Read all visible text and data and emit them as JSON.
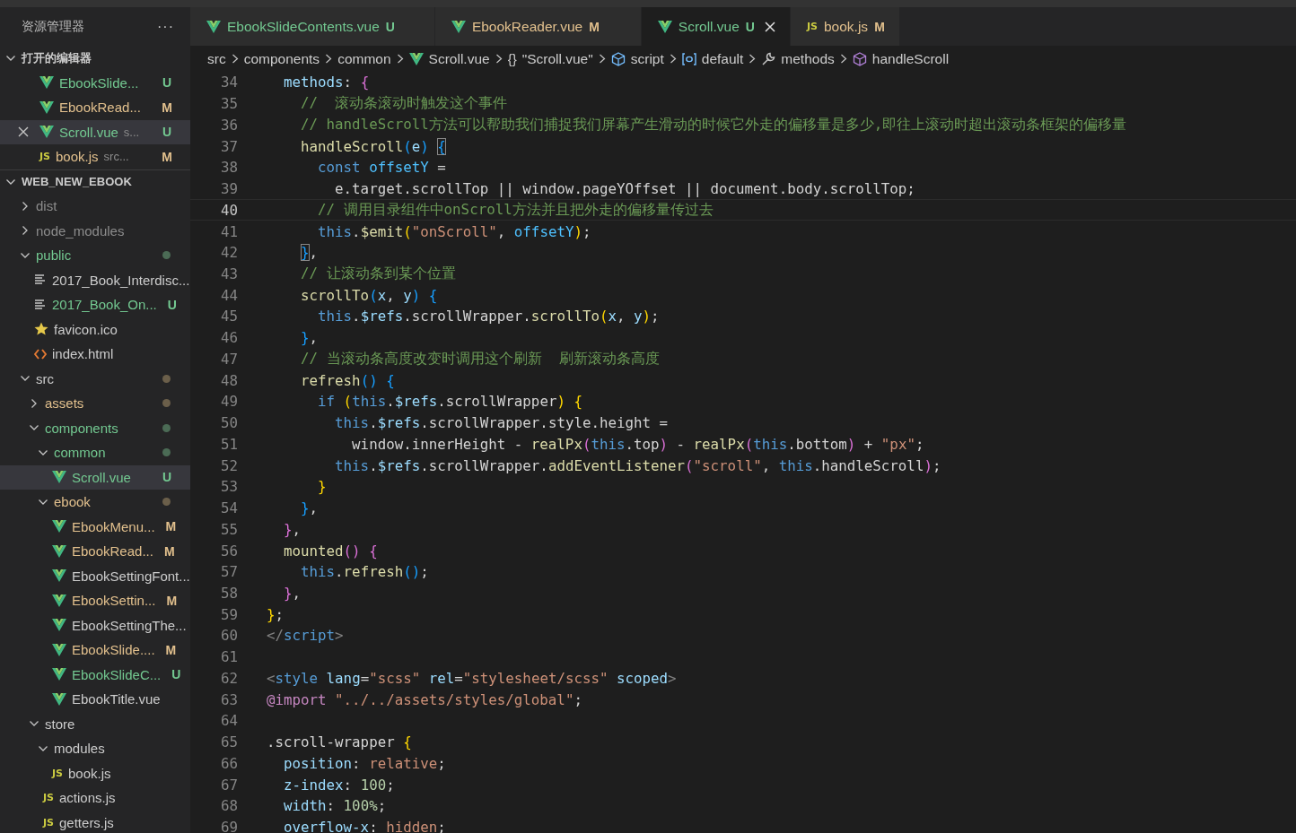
{
  "tabs": [
    {
      "label": "EbookSlideContents.vue",
      "kind": "vue",
      "status": "U",
      "color": "#73c991",
      "selected": false
    },
    {
      "label": "EbookReader.vue",
      "kind": "vue",
      "status": "M",
      "color": "#e2c08d",
      "selected": false
    },
    {
      "label": "Scroll.vue",
      "kind": "vue",
      "status": "U",
      "color": "#73c991",
      "selected": true
    },
    {
      "label": "book.js",
      "kind": "js",
      "icon_label": "JS",
      "status": "M",
      "color": "#e2c08d",
      "selected": false
    }
  ],
  "sidebar": {
    "title": "资源管理器",
    "more": "···",
    "open_editors": {
      "title": "打开的编辑器",
      "expanded": true,
      "items": [
        {
          "kind": "vue",
          "name": "EbookSlide...",
          "status": "U",
          "color": "#73c991",
          "selected": false
        },
        {
          "kind": "vue",
          "name": "EbookRead...",
          "status": "M",
          "color": "#e2c08d",
          "selected": false
        },
        {
          "kind": "vue",
          "name": "Scroll.vue",
          "description": "s...",
          "status": "U",
          "color": "#73c991",
          "selected": true
        },
        {
          "kind": "js",
          "icon_label": "JS",
          "name": "book.js",
          "description": "src...",
          "status": "M",
          "color": "#e2c08d",
          "selected": false
        }
      ]
    },
    "folder": {
      "title": "WEB_NEW_EBOOK",
      "expanded": true,
      "children": [
        {
          "label": "dist",
          "kind": "folder",
          "expanded": false,
          "color": "#8c8c8c",
          "selected": false
        },
        {
          "label": "node_modules",
          "kind": "folder",
          "expanded": false,
          "color": "#8c8c8c",
          "selected": false
        },
        {
          "label": "public",
          "kind": "folder",
          "expanded": true,
          "color": "#73c991",
          "dot": {
            "color": "#4b6b55"
          },
          "selected": false,
          "children": [
            {
              "label": "2017_Book_Interdisc...",
              "kind": "text",
              "color": "#cccccc",
              "selected": false
            },
            {
              "label": "2017_Book_On...",
              "kind": "text",
              "color": "#73c991",
              "status": "U",
              "selected": false
            },
            {
              "label": "favicon.ico",
              "kind": "star",
              "color": "#cccccc",
              "selected": false
            },
            {
              "label": "index.html",
              "kind": "html",
              "color": "#cccccc",
              "selected": false
            }
          ]
        },
        {
          "label": "src",
          "kind": "folder",
          "expanded": true,
          "color": "#cccccc",
          "dot": {
            "color": "#6b5f4a"
          },
          "selected": false,
          "children": [
            {
              "label": "assets",
              "kind": "folder",
              "expanded": false,
              "color": "#e2c08d",
              "dot": {
                "color": "#6b5f4a"
              },
              "selected": false
            },
            {
              "label": "components",
              "kind": "folder",
              "expanded": true,
              "color": "#73c991",
              "dot": {
                "color": "#4b6b55"
              },
              "selected": false,
              "children": [
                {
                  "label": "common",
                  "kind": "folder",
                  "expanded": true,
                  "color": "#73c991",
                  "dot": {
                    "color": "#4b6b55"
                  },
                  "selected": false,
                  "children": [
                    {
                      "label": "Scroll.vue",
                      "kind": "vue",
                      "color": "#73c991",
                      "status": "U",
                      "selected": true
                    }
                  ]
                },
                {
                  "label": "ebook",
                  "kind": "folder",
                  "expanded": true,
                  "color": "#e2c08d",
                  "dot": {
                    "color": "#6b5f4a"
                  },
                  "selected": false,
                  "children": [
                    {
                      "label": "EbookMenu...",
                      "kind": "vue",
                      "color": "#e2c08d",
                      "status": "M",
                      "selected": false
                    },
                    {
                      "label": "EbookRead...",
                      "kind": "vue",
                      "color": "#e2c08d",
                      "status": "M",
                      "selected": false
                    },
                    {
                      "label": "EbookSettingFont...",
                      "kind": "vue",
                      "color": "#cccccc",
                      "selected": false
                    },
                    {
                      "label": "EbookSettin...",
                      "kind": "vue",
                      "color": "#e2c08d",
                      "status": "M",
                      "selected": false
                    },
                    {
                      "label": "EbookSettingThe...",
                      "kind": "vue",
                      "color": "#cccccc",
                      "selected": false
                    },
                    {
                      "label": "EbookSlide....",
                      "kind": "vue",
                      "color": "#e2c08d",
                      "status": "M",
                      "selected": false
                    },
                    {
                      "label": "EbookSlideC...",
                      "kind": "vue",
                      "color": "#73c991",
                      "status": "U",
                      "selected": false
                    },
                    {
                      "label": "EbookTitle.vue",
                      "kind": "vue",
                      "color": "#cccccc",
                      "selected": false
                    }
                  ]
                }
              ]
            },
            {
              "label": "store",
              "kind": "folder",
              "expanded": true,
              "color": "#cccccc",
              "selected": false,
              "children": [
                {
                  "label": "modules",
                  "kind": "folder",
                  "expanded": true,
                  "color": "#cccccc",
                  "selected": false,
                  "children": [
                    {
                      "label": "book.js",
                      "kind": "js",
                      "icon_label": "JS",
                      "color": "#cccccc",
                      "selected": false
                    }
                  ]
                },
                {
                  "label": "actions.js",
                  "kind": "js",
                  "icon_label": "JS",
                  "color": "#cccccc",
                  "selected": false
                },
                {
                  "label": "getters.js",
                  "kind": "js",
                  "icon_label": "JS",
                  "color": "#cccccc",
                  "selected": false
                }
              ]
            }
          ]
        }
      ]
    }
  },
  "breadcrumbs": [
    {
      "kind": "plain",
      "label": "src"
    },
    {
      "kind": "plain",
      "label": "components"
    },
    {
      "kind": "plain",
      "label": "common"
    },
    {
      "kind": "vue",
      "label": "Scroll.vue"
    },
    {
      "kind": "glyph",
      "glyph": "{}",
      "label": "\"Scroll.vue\""
    },
    {
      "kind": "cube",
      "label": "script"
    },
    {
      "kind": "field",
      "label": "default"
    },
    {
      "kind": "wrench",
      "label": "methods"
    },
    {
      "kind": "method",
      "label": "handleScroll"
    }
  ],
  "editor": {
    "lines": [
      {
        "number": "34",
        "current": false,
        "tokens": [
          {
            "kind": "prop",
            "text": "  methods"
          },
          {
            "kind": "plain",
            "text": ": "
          },
          {
            "kind": "pink",
            "text": "{"
          }
        ]
      },
      {
        "number": "35",
        "current": false,
        "tokens": [
          {
            "kind": "comment",
            "text": "    //  滚动条滚动时触发这个事件"
          }
        ]
      },
      {
        "number": "36",
        "current": false,
        "tokens": [
          {
            "kind": "comment",
            "text": "    // handleScroll方法可以帮助我们捕捉我们屏幕产生滑动的时候它外走的偏移量是多少,即往上滚动时超出滚动条框架的偏移量"
          }
        ]
      },
      {
        "number": "37",
        "current": false,
        "tokens": [
          {
            "kind": "fn",
            "text": "    handleScroll"
          },
          {
            "kind": "blue",
            "text": "("
          },
          {
            "kind": "var",
            "text": "e"
          },
          {
            "kind": "blue",
            "text": ") "
          },
          {
            "kind": "match",
            "text": "{"
          }
        ]
      },
      {
        "number": "38",
        "current": false,
        "tokens": [
          {
            "kind": "keyword",
            "text": "      const "
          },
          {
            "kind": "const",
            "text": "offsetY"
          },
          {
            "kind": "plain",
            "text": " ="
          }
        ]
      },
      {
        "number": "39",
        "current": false,
        "tokens": [
          {
            "kind": "plain",
            "text": "        e.target.scrollTop || window.pageYOffset || document.body.scrollTop;"
          }
        ]
      },
      {
        "number": "40",
        "current": true,
        "tokens": [
          {
            "kind": "comment",
            "text": "      // 调用目录组件中onScroll方法并且把外走的偏移量传过去"
          }
        ]
      },
      {
        "number": "41",
        "current": false,
        "tokens": [
          {
            "kind": "keyword",
            "text": "      this"
          },
          {
            "kind": "plain",
            "text": "."
          },
          {
            "kind": "fn",
            "text": "$emit"
          },
          {
            "kind": "gold",
            "text": "("
          },
          {
            "kind": "string",
            "text": "\"onScroll\""
          },
          {
            "kind": "plain",
            "text": ", "
          },
          {
            "kind": "const",
            "text": "offsetY"
          },
          {
            "kind": "gold",
            "text": ")"
          },
          {
            "kind": "plain",
            "text": ";"
          }
        ]
      },
      {
        "number": "42",
        "current": false,
        "tokens": [
          {
            "kind": "match",
            "text": "    }"
          },
          {
            "kind": "plain",
            "text": ","
          }
        ]
      },
      {
        "number": "43",
        "current": false,
        "tokens": [
          {
            "kind": "comment",
            "text": "    // 让滚动条到某个位置"
          }
        ]
      },
      {
        "number": "44",
        "current": false,
        "tokens": [
          {
            "kind": "fn",
            "text": "    scrollTo"
          },
          {
            "kind": "blue",
            "text": "("
          },
          {
            "kind": "var",
            "text": "x"
          },
          {
            "kind": "plain",
            "text": ", "
          },
          {
            "kind": "var",
            "text": "y"
          },
          {
            "kind": "blue",
            "text": ") {"
          }
        ]
      },
      {
        "number": "45",
        "current": false,
        "tokens": [
          {
            "kind": "keyword",
            "text": "      this"
          },
          {
            "kind": "plain",
            "text": "."
          },
          {
            "kind": "var",
            "text": "$refs"
          },
          {
            "kind": "plain",
            "text": ".scrollWrapper."
          },
          {
            "kind": "fn",
            "text": "scrollTo"
          },
          {
            "kind": "gold",
            "text": "("
          },
          {
            "kind": "var",
            "text": "x"
          },
          {
            "kind": "plain",
            "text": ", "
          },
          {
            "kind": "var",
            "text": "y"
          },
          {
            "kind": "gold",
            "text": ")"
          },
          {
            "kind": "plain",
            "text": ";"
          }
        ]
      },
      {
        "number": "46",
        "current": false,
        "tokens": [
          {
            "kind": "blue",
            "text": "    }"
          },
          {
            "kind": "plain",
            "text": ","
          }
        ]
      },
      {
        "number": "47",
        "current": false,
        "tokens": [
          {
            "kind": "comment",
            "text": "    // 当滚动条高度改变时调用这个刷新  刷新滚动条高度"
          }
        ]
      },
      {
        "number": "48",
        "current": false,
        "tokens": [
          {
            "kind": "fn",
            "text": "    refresh"
          },
          {
            "kind": "blue",
            "text": "() {"
          }
        ]
      },
      {
        "number": "49",
        "current": false,
        "tokens": [
          {
            "kind": "keyword",
            "text": "      if "
          },
          {
            "kind": "gold",
            "text": "("
          },
          {
            "kind": "keyword",
            "text": "this"
          },
          {
            "kind": "plain",
            "text": "."
          },
          {
            "kind": "var",
            "text": "$refs"
          },
          {
            "kind": "plain",
            "text": ".scrollWrapper"
          },
          {
            "kind": "gold",
            "text": ") {"
          }
        ]
      },
      {
        "number": "50",
        "current": false,
        "tokens": [
          {
            "kind": "keyword",
            "text": "        this"
          },
          {
            "kind": "plain",
            "text": "."
          },
          {
            "kind": "var",
            "text": "$refs"
          },
          {
            "kind": "plain",
            "text": ".scrollWrapper.style.height ="
          }
        ]
      },
      {
        "number": "51",
        "current": false,
        "tokens": [
          {
            "kind": "plain",
            "text": "          window.innerHeight - "
          },
          {
            "kind": "fn",
            "text": "realPx"
          },
          {
            "kind": "pink",
            "text": "("
          },
          {
            "kind": "keyword",
            "text": "this"
          },
          {
            "kind": "plain",
            "text": ".top"
          },
          {
            "kind": "pink",
            "text": ")"
          },
          {
            "kind": "plain",
            "text": " - "
          },
          {
            "kind": "fn",
            "text": "realPx"
          },
          {
            "kind": "pink",
            "text": "("
          },
          {
            "kind": "keyword",
            "text": "this"
          },
          {
            "kind": "plain",
            "text": ".bottom"
          },
          {
            "kind": "pink",
            "text": ")"
          },
          {
            "kind": "plain",
            "text": " + "
          },
          {
            "kind": "string",
            "text": "\"px\""
          },
          {
            "kind": "plain",
            "text": ";"
          }
        ]
      },
      {
        "number": "52",
        "current": false,
        "tokens": [
          {
            "kind": "keyword",
            "text": "        this"
          },
          {
            "kind": "plain",
            "text": "."
          },
          {
            "kind": "var",
            "text": "$refs"
          },
          {
            "kind": "plain",
            "text": ".scrollWrapper."
          },
          {
            "kind": "fn",
            "text": "addEventListener"
          },
          {
            "kind": "pink",
            "text": "("
          },
          {
            "kind": "string",
            "text": "\"scroll\""
          },
          {
            "kind": "plain",
            "text": ", "
          },
          {
            "kind": "keyword",
            "text": "this"
          },
          {
            "kind": "plain",
            "text": ".handleScroll"
          },
          {
            "kind": "pink",
            "text": ")"
          },
          {
            "kind": "plain",
            "text": ";"
          }
        ]
      },
      {
        "number": "53",
        "current": false,
        "tokens": [
          {
            "kind": "gold",
            "text": "      }"
          }
        ]
      },
      {
        "number": "54",
        "current": false,
        "tokens": [
          {
            "kind": "blue",
            "text": "    }"
          },
          {
            "kind": "plain",
            "text": ","
          }
        ]
      },
      {
        "number": "55",
        "current": false,
        "tokens": [
          {
            "kind": "pink",
            "text": "  }"
          },
          {
            "kind": "plain",
            "text": ","
          }
        ]
      },
      {
        "number": "56",
        "current": false,
        "tokens": [
          {
            "kind": "fn",
            "text": "  mounted"
          },
          {
            "kind": "pink",
            "text": "() {"
          }
        ]
      },
      {
        "number": "57",
        "current": false,
        "tokens": [
          {
            "kind": "keyword",
            "text": "    this"
          },
          {
            "kind": "plain",
            "text": "."
          },
          {
            "kind": "fn",
            "text": "refresh"
          },
          {
            "kind": "blue",
            "text": "()"
          },
          {
            "kind": "plain",
            "text": ";"
          }
        ]
      },
      {
        "number": "58",
        "current": false,
        "tokens": [
          {
            "kind": "pink",
            "text": "  }"
          },
          {
            "kind": "plain",
            "text": ","
          }
        ]
      },
      {
        "number": "59",
        "current": false,
        "tokens": [
          {
            "kind": "gold",
            "text": "}"
          },
          {
            "kind": "plain",
            "text": ";"
          }
        ]
      },
      {
        "number": "60",
        "current": false,
        "tokens": [
          {
            "kind": "tag",
            "text": "</"
          },
          {
            "kind": "keyword",
            "text": "script"
          },
          {
            "kind": "tag",
            "text": ">"
          }
        ]
      },
      {
        "number": "61",
        "current": false
      },
      {
        "number": "62",
        "current": false,
        "tokens": [
          {
            "kind": "tag",
            "text": "<"
          },
          {
            "kind": "keyword",
            "text": "style "
          },
          {
            "kind": "var",
            "text": "lang"
          },
          {
            "kind": "plain",
            "text": "="
          },
          {
            "kind": "string",
            "text": "\"scss\" "
          },
          {
            "kind": "var",
            "text": "rel"
          },
          {
            "kind": "plain",
            "text": "="
          },
          {
            "kind": "string",
            "text": "\"stylesheet/scss\" "
          },
          {
            "kind": "var",
            "text": "scoped"
          },
          {
            "kind": "tag",
            "text": ">"
          }
        ]
      },
      {
        "number": "63",
        "current": false,
        "tokens": [
          {
            "kind": "atrule",
            "text": "@import "
          },
          {
            "kind": "string",
            "text": "\"../../assets/styles/global\""
          },
          {
            "kind": "plain",
            "text": ";"
          }
        ]
      },
      {
        "number": "64",
        "current": false
      },
      {
        "number": "65",
        "current": false,
        "tokens": [
          {
            "kind": "plain",
            "text": ".scroll-wrapper "
          },
          {
            "kind": "gold",
            "text": "{"
          }
        ]
      },
      {
        "number": "66",
        "current": false,
        "tokens": [
          {
            "kind": "var",
            "text": "  position"
          },
          {
            "kind": "plain",
            "text": ": "
          },
          {
            "kind": "string",
            "text": "relative"
          },
          {
            "kind": "plain",
            "text": ";"
          }
        ]
      },
      {
        "number": "67",
        "current": false,
        "tokens": [
          {
            "kind": "var",
            "text": "  z-index"
          },
          {
            "kind": "plain",
            "text": ": "
          },
          {
            "kind": "number",
            "text": "100"
          },
          {
            "kind": "plain",
            "text": ";"
          }
        ]
      },
      {
        "number": "68",
        "current": false,
        "tokens": [
          {
            "kind": "var",
            "text": "  width"
          },
          {
            "kind": "plain",
            "text": ": "
          },
          {
            "kind": "number",
            "text": "100%"
          },
          {
            "kind": "plain",
            "text": ";"
          }
        ]
      },
      {
        "number": "69",
        "current": false,
        "tokens": [
          {
            "kind": "var",
            "text": "  overflow-x"
          },
          {
            "kind": "plain",
            "text": ": "
          },
          {
            "kind": "string",
            "text": "hidden"
          },
          {
            "kind": "plain",
            "text": ";"
          }
        ]
      }
    ]
  }
}
